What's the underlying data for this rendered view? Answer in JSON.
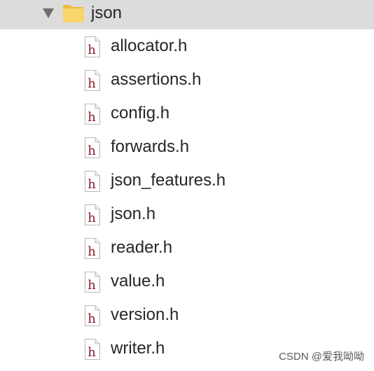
{
  "folder": {
    "name": "json",
    "icon": "folder-icon",
    "expanded": true,
    "row_color": "#dcdcdc",
    "folder_color": "#f5c84e"
  },
  "files": [
    {
      "name": "allocator.h",
      "icon": "header-file-icon"
    },
    {
      "name": "assertions.h",
      "icon": "header-file-icon"
    },
    {
      "name": "config.h",
      "icon": "header-file-icon"
    },
    {
      "name": "forwards.h",
      "icon": "header-file-icon"
    },
    {
      "name": "json_features.h",
      "icon": "header-file-icon"
    },
    {
      "name": "json.h",
      "icon": "header-file-icon"
    },
    {
      "name": "reader.h",
      "icon": "header-file-icon"
    },
    {
      "name": "value.h",
      "icon": "header-file-icon"
    },
    {
      "name": "version.h",
      "icon": "header-file-icon"
    },
    {
      "name": "writer.h",
      "icon": "header-file-icon"
    }
  ],
  "file_icon_letter": "h",
  "file_icon_letter_color": "#8b1a2b",
  "watermark": "CSDN @爱我呦呦"
}
